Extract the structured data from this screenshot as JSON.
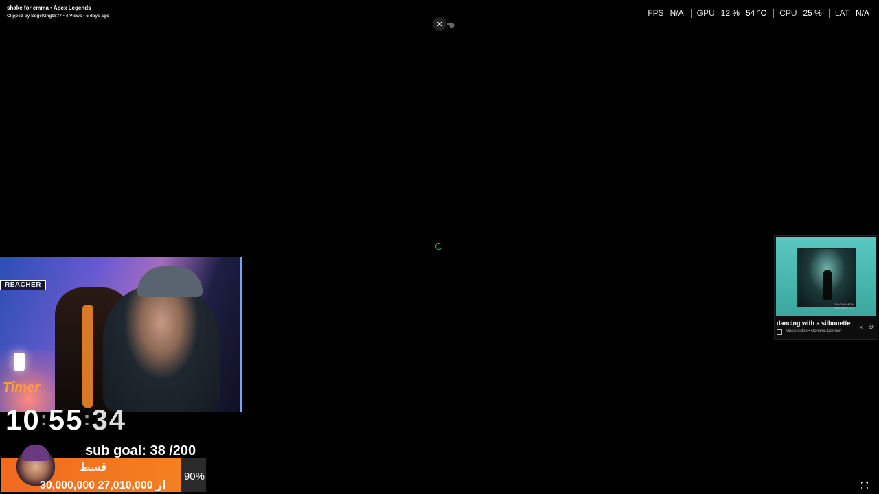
{
  "clip": {
    "title": "shake for emma • Apex Legends",
    "meta": "Clipped by SogeKing9877 • 4 Views • 5 days ago"
  },
  "perf": {
    "fps_label": "FPS",
    "fps_value": "N/A",
    "gpu_label": "GPU",
    "gpu_usage": "12 %",
    "gpu_temp": "54 °C",
    "cpu_label": "CPU",
    "cpu_usage": "25 %",
    "lat_label": "LAT",
    "lat_value": "N/A"
  },
  "close_glyph": "✕",
  "webcam": {
    "tag": "REACHER",
    "timer_label": "Timer"
  },
  "clock": {
    "hours": "10",
    "minutes": "55",
    "seconds": "34",
    "sep": ":"
  },
  "sub_goal": "sub goal: 38 /200",
  "donation": {
    "title": "قسط",
    "amount": "30,000,000 از 27,010,000",
    "percent_text": "90%",
    "percent": 90
  },
  "mini_player": {
    "title": "dancing with a silhouette",
    "subtitle": "Music video • Dominic Donner",
    "art_text": "DANCING WITH A SILHOUETTE",
    "close_glyph": "×",
    "more_glyph": "⊕"
  },
  "colors": {
    "background": "#000000",
    "spinner": "#3fbf3f",
    "donation_bar": "#f06a20",
    "timer_label": "#ffa030"
  }
}
